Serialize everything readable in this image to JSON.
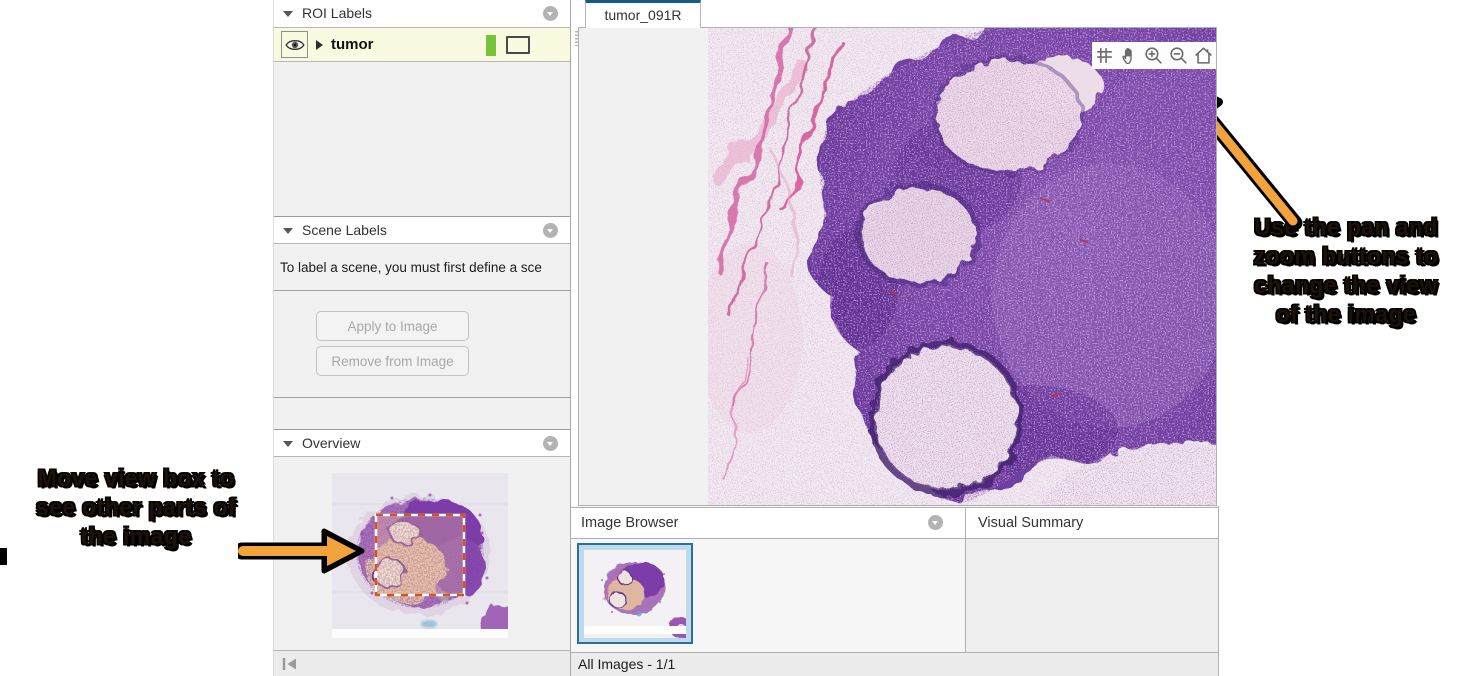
{
  "left_panel": {
    "roi_labels": {
      "title": "ROI Labels",
      "items": [
        {
          "name": "tumor",
          "color": "#78c33d",
          "shape": "rectangle",
          "visible": true
        }
      ]
    },
    "scene_labels": {
      "title": "Scene Labels",
      "message": "To label a scene, you must first define a sce",
      "apply_button": "Apply to Image",
      "remove_button": "Remove from Image"
    },
    "overview": {
      "title": "Overview"
    }
  },
  "viewer": {
    "tab": "tumor_091R",
    "toolbar_icons": [
      "grid",
      "pan-hand",
      "zoom-in",
      "zoom-out",
      "home"
    ]
  },
  "bottom_panel": {
    "image_browser_title": "Image Browser",
    "visual_summary_title": "Visual Summary",
    "status": "All Images - 1/1"
  },
  "annotations": {
    "pan_zoom_note": {
      "lines": [
        "Use the pan and",
        "zoom buttons to",
        "change the view",
        "of the image"
      ]
    },
    "view_box_note": {
      "lines": [
        "Move view box to",
        "see other parts of",
        "the image"
      ]
    }
  },
  "colors": {
    "tab_accent": "#155d87",
    "roi_selection_bg": "#fafae1",
    "roi_label_green": "#78c33d",
    "view_box_orange": "#d4541c",
    "arrow_orange": "#f2a33c",
    "thumb_border_blue": "#2e6e99",
    "thumb_bg_blue": "#bedbee"
  }
}
